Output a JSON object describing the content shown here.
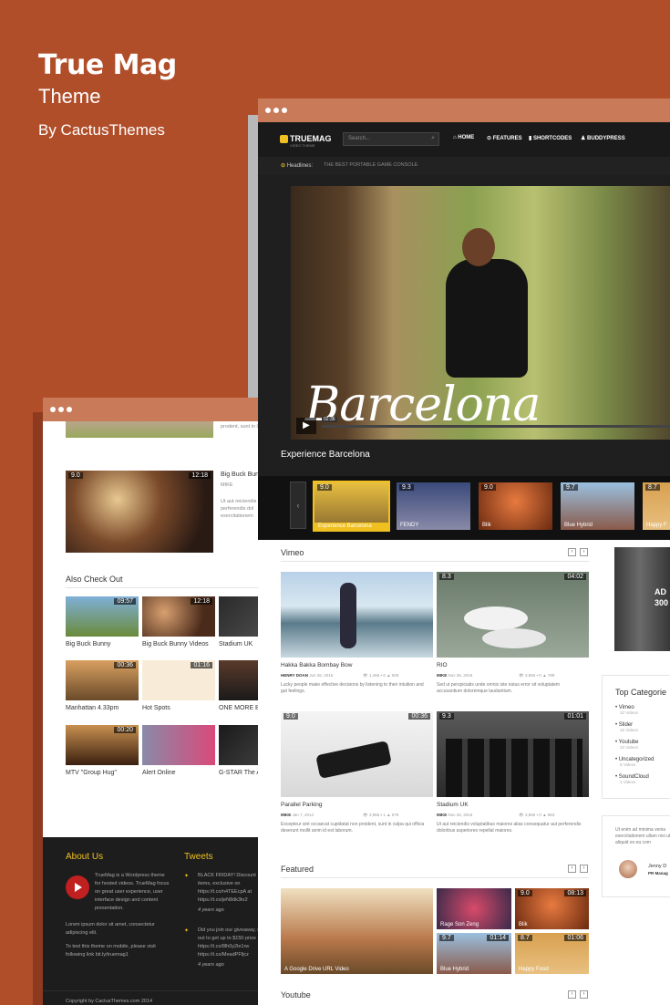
{
  "brand": {
    "title": "True Mag",
    "subtitle": "Theme",
    "byline": "By CactusThemes"
  },
  "small_window": {
    "top_snippet": "prodent, sunt in labourn",
    "row1": {
      "score": "9.0",
      "duration": "12:18",
      "side_title": "Big Buck Bunn",
      "side_meta": "MIKE",
      "side_desc": "Ut aut reiciendis perferendis dol exercitationem"
    },
    "also_check_out": "Also Check Out",
    "grid": [
      {
        "title": "Big Buck Bunny",
        "duration": "09:57"
      },
      {
        "title": "Big Buck Bunny Videos",
        "duration": "12:18"
      },
      {
        "title": "Stadium UK",
        "duration": ""
      },
      {
        "title": "Manhattan 4.33pm",
        "duration": "00:36"
      },
      {
        "title": "Hot Spots",
        "duration": "01:16"
      },
      {
        "title": "ONE MORE BE",
        "duration": ""
      },
      {
        "title": "MTV \"Group Hug\"",
        "duration": "00:20"
      },
      {
        "title": "Alert Online",
        "duration": ""
      },
      {
        "title": "G-STAR The A",
        "duration": ""
      }
    ],
    "footer": {
      "about_heading": "About Us",
      "about_text": "TrueMag is a Wordpress theme for hosted videos. TrueMag focus on great user experience, user interface design and content presentation.",
      "lorem": "Lorem ipsum dolor sit amet, consectetur adipiscing elit.",
      "mobile": "To test this theme on mobile, please visit following link bit.ly/truemag1",
      "tweets_heading": "Tweets",
      "tweet1": "BLACK FRIDAY! Discount items, exclusive on https://t.co/n4TEEcpA at https://t.co/jeN8dk3kr2",
      "tweet1_time": "4 years ago",
      "tweet2": "Did you join our giveaway, if out to get up to $150 prize https://t.co/8lh0y2le1rw https://t.co/MeadPFfjcz",
      "tweet2_time": "4 years ago",
      "copyright": "Copyright by CactusThemes.com 2014"
    }
  },
  "main_window": {
    "logo": "TRUEMAG",
    "logo_sub": "VIDEO THEME",
    "search_placeholder": "Search...",
    "nav": [
      "HOME",
      "FEATURES",
      "SHORTCODES",
      "BUDDYPRESS"
    ],
    "headlines_label": "Headlines:",
    "headline": "THE BEST PORTABLE GAME CONSOLE",
    "video_overlay": "Barcelona",
    "video_time": "02:36",
    "video_caption": "Experience Barcelona",
    "thumbs": [
      {
        "score": "9.0",
        "title": "Experience Barcelona"
      },
      {
        "score": "9.3",
        "title": "FENDY"
      },
      {
        "score": "9.0",
        "title": "Blik"
      },
      {
        "score": "9.7",
        "title": "Blue Hybrid"
      },
      {
        "score": "8.7",
        "title": "Happy F"
      }
    ],
    "vimeo": {
      "heading": "Vimeo",
      "items": [
        {
          "title": "Hakka Bakka Bombay Bow",
          "author": "HENRY DOAN",
          "date": "Jun 26, 2015",
          "views": "1,456",
          "comments": "0",
          "likes": "505",
          "score": "",
          "duration": "",
          "desc": "Lucky people make effective decisions by listening to their intuition and gut feelings."
        },
        {
          "title": "RIO",
          "author": "MIKE",
          "date": "Nov 26, 2016",
          "views": "3,956",
          "comments": "0",
          "likes": "789",
          "score": "8.3",
          "duration": "04:02",
          "desc": "Sed ut perspiciatis unde omnis iste natus error sit voluptatem accusantium doloremque laudantium."
        },
        {
          "title": "Parallel Parking",
          "author": "MIKE",
          "date": "Jan 7, 2014",
          "views": "3,956",
          "comments": "1",
          "likes": "576",
          "score": "9.0",
          "duration": "00:36",
          "desc": "Excepteur sint occaecat cupidatat non proident, sunt in culpa qui officia deserunt mollit anim id est laborum."
        },
        {
          "title": "Stadium UK",
          "author": "MIKE",
          "date": "Nov 26, 2016",
          "views": "3,956",
          "comments": "0",
          "likes": "863",
          "score": "9.3",
          "duration": "01:01",
          "desc": "Ut aut reiciendis voluptatibus maiores alias consequatur aut perferendis doloribus asperiores repellat maiores."
        }
      ]
    },
    "featured": {
      "heading": "Featured",
      "items": [
        {
          "title": "A Google Drive URL Video",
          "score": "",
          "duration": ""
        },
        {
          "title": "Rage Son Zeng",
          "score": "",
          "duration": ""
        },
        {
          "title": "Blik",
          "score": "9.0",
          "duration": "08:13"
        },
        {
          "title": "Blue Hybrid",
          "score": "9.7",
          "duration": "01:14"
        },
        {
          "title": "Happy Food",
          "score": "8.7",
          "duration": "01:06"
        }
      ]
    },
    "youtube_heading": "Youtube",
    "ad": {
      "line1": "AD",
      "line2": "300"
    },
    "top_categories": {
      "heading": "Top Categorie",
      "items": [
        {
          "name": "Vimeo",
          "count": "10 Videos"
        },
        {
          "name": "Slider",
          "count": "16 Videos"
        },
        {
          "name": "Youtube",
          "count": "10 Videos"
        },
        {
          "name": "Uncategorized",
          "count": "8 Videos"
        },
        {
          "name": "SoundCloud",
          "count": "1 Videos"
        }
      ]
    },
    "testimonial": {
      "text": "Ut enim ad minima venia exercitationem ullam nisi ut aliquid ex ea com",
      "name": "Jenny D",
      "role": "PR Manag"
    }
  },
  "colors": {
    "background": "#b14e2a",
    "accent": "#f0c020",
    "titlebar": "#c97a58"
  }
}
